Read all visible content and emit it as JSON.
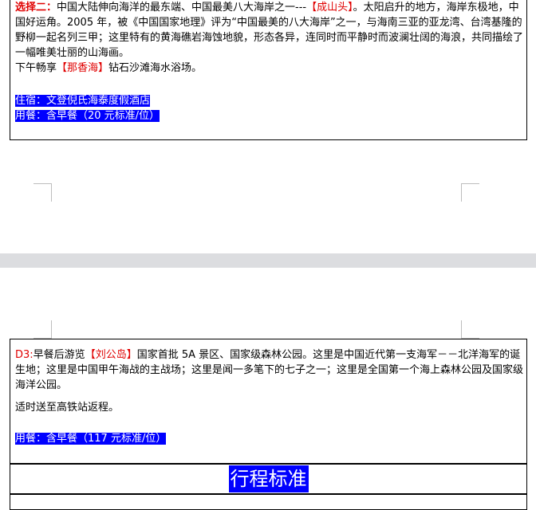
{
  "page1": {
    "option2": {
      "label": "选择二：",
      "text1": "中国大陆伸向海洋的最东端、中国最美八大海岸之一---",
      "place": "【成山头】",
      "text2": "。太阳启升的地方，海岸东极地，中国好运角。2005 年，被《中国国家地理》评为“中国最美的八大海岸”之一，与海南三亚的亚龙湾、台湾基隆的野柳一起名列三甲；这里特有的黄海礁岩海蚀地貌，形态各异，连同时而平静时而波澜壮阔的海浪，共同描绘了一幅唯美壮丽的山海画。"
    },
    "afternoon": {
      "text1": "下午畅享",
      "place": "【那香海】",
      "text2": "钻石沙滩海水浴场。"
    },
    "hotel": "住宿：文登倪氏海泰度假酒店",
    "meal": "用餐：含早餐（20 元标准/位）"
  },
  "page2": {
    "day3": {
      "label": "D3:",
      "text1": "早餐后游览",
      "place": "【刘公岛】",
      "text2": "国家首批 5A 景区、国家级森林公园。这里是中国近代第一支海军－－北洋海军的诞生地；这里是中国甲午海战的主战场；这里是闻一多笔下的七子之一；这里是全国第一个海上森林公园及国家级海洋公园。",
      "text3": "适时送至高铁站返程。"
    },
    "meal": "用餐：含早餐（117 元标准/位）",
    "section_title": "行程标准"
  },
  "colors": {
    "highlight": "#0000ff",
    "accent_red": "#e00000",
    "page_gap": "#dcdde0"
  }
}
